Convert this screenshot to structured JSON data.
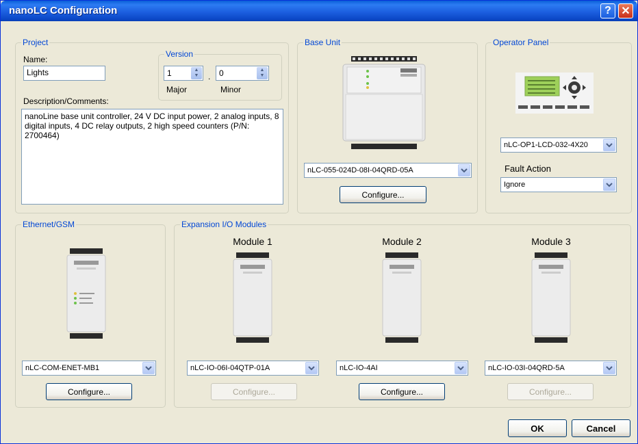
{
  "window": {
    "title": "nanoLC Configuration",
    "help_label": "?",
    "close_label": "✕"
  },
  "project": {
    "legend": "Project",
    "name_label": "Name:",
    "name_value": "Lights",
    "description_label": "Description/Comments:",
    "description_value": "nanoLine base unit controller, 24 V DC input power, 2 analog inputs, 8 digital inputs, 4 DC relay outputs, 2 high speed counters  (P/N: 2700464)",
    "version": {
      "legend": "Version",
      "major_value": "1",
      "minor_value": "0",
      "separator": ".",
      "major_label": "Major",
      "minor_label": "Minor"
    }
  },
  "base_unit": {
    "legend": "Base Unit",
    "model": "nLC-055-024D-08I-04QRD-05A",
    "configure_label": "Configure..."
  },
  "operator_panel": {
    "legend": "Operator Panel",
    "model": "nLC-OP1-LCD-032-4X20",
    "fault_action_label": "Fault Action",
    "fault_action_value": "Ignore"
  },
  "ethernet": {
    "legend": "Ethernet/GSM",
    "model": "nLC-COM-ENET-MB1",
    "configure_label": "Configure..."
  },
  "expansion": {
    "legend": "Expansion I/O Modules",
    "modules": [
      {
        "title": "Module 1",
        "model": "nLC-IO-06I-04QTP-01A",
        "configure_label": "Configure...",
        "configure_enabled": false
      },
      {
        "title": "Module 2",
        "model": "nLC-IO-4AI",
        "configure_label": "Configure...",
        "configure_enabled": true
      },
      {
        "title": "Module 3",
        "model": "nLC-IO-03I-04QRD-5A",
        "configure_label": "Configure...",
        "configure_enabled": false
      }
    ]
  },
  "footer": {
    "ok_label": "OK",
    "cancel_label": "Cancel"
  },
  "colors": {
    "titlebar": "#0A5FD8",
    "legend_text": "#0046D5",
    "dialog_bg": "#ECE9D8",
    "button_border": "#003C74"
  }
}
